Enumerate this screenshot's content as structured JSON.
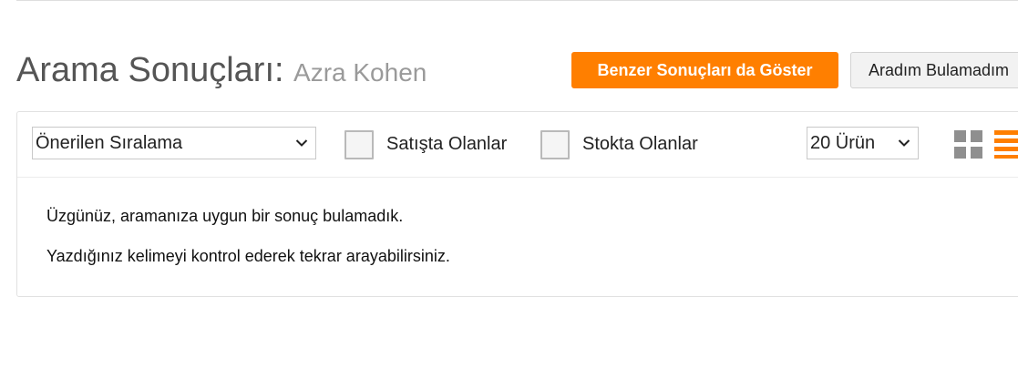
{
  "header": {
    "title": "Arama Sonuçları:",
    "query": "Azra Kohen"
  },
  "actions": {
    "show_similar_label": "Benzer Sonuçları da Göster",
    "not_found_label": "Aradım Bulamadım"
  },
  "toolbar": {
    "sort_selected": "Önerilen Sıralama",
    "on_sale_label": "Satışta Olanlar",
    "in_stock_label": "Stokta Olanlar",
    "page_size_selected": "20 Ürün",
    "view_icons": [
      "grid-view-icon",
      "list-view-icon"
    ]
  },
  "results": {
    "empty_message": "Üzgünüz, aramanıza uygun bir sonuç bulamadık.",
    "hint_message": "Yazdığınız kelimeyi kontrol ederek tekrar arayabilirsiniz."
  },
  "colors": {
    "accent": "#ff7f00",
    "title": "#555555",
    "query": "#9a9a9a"
  }
}
